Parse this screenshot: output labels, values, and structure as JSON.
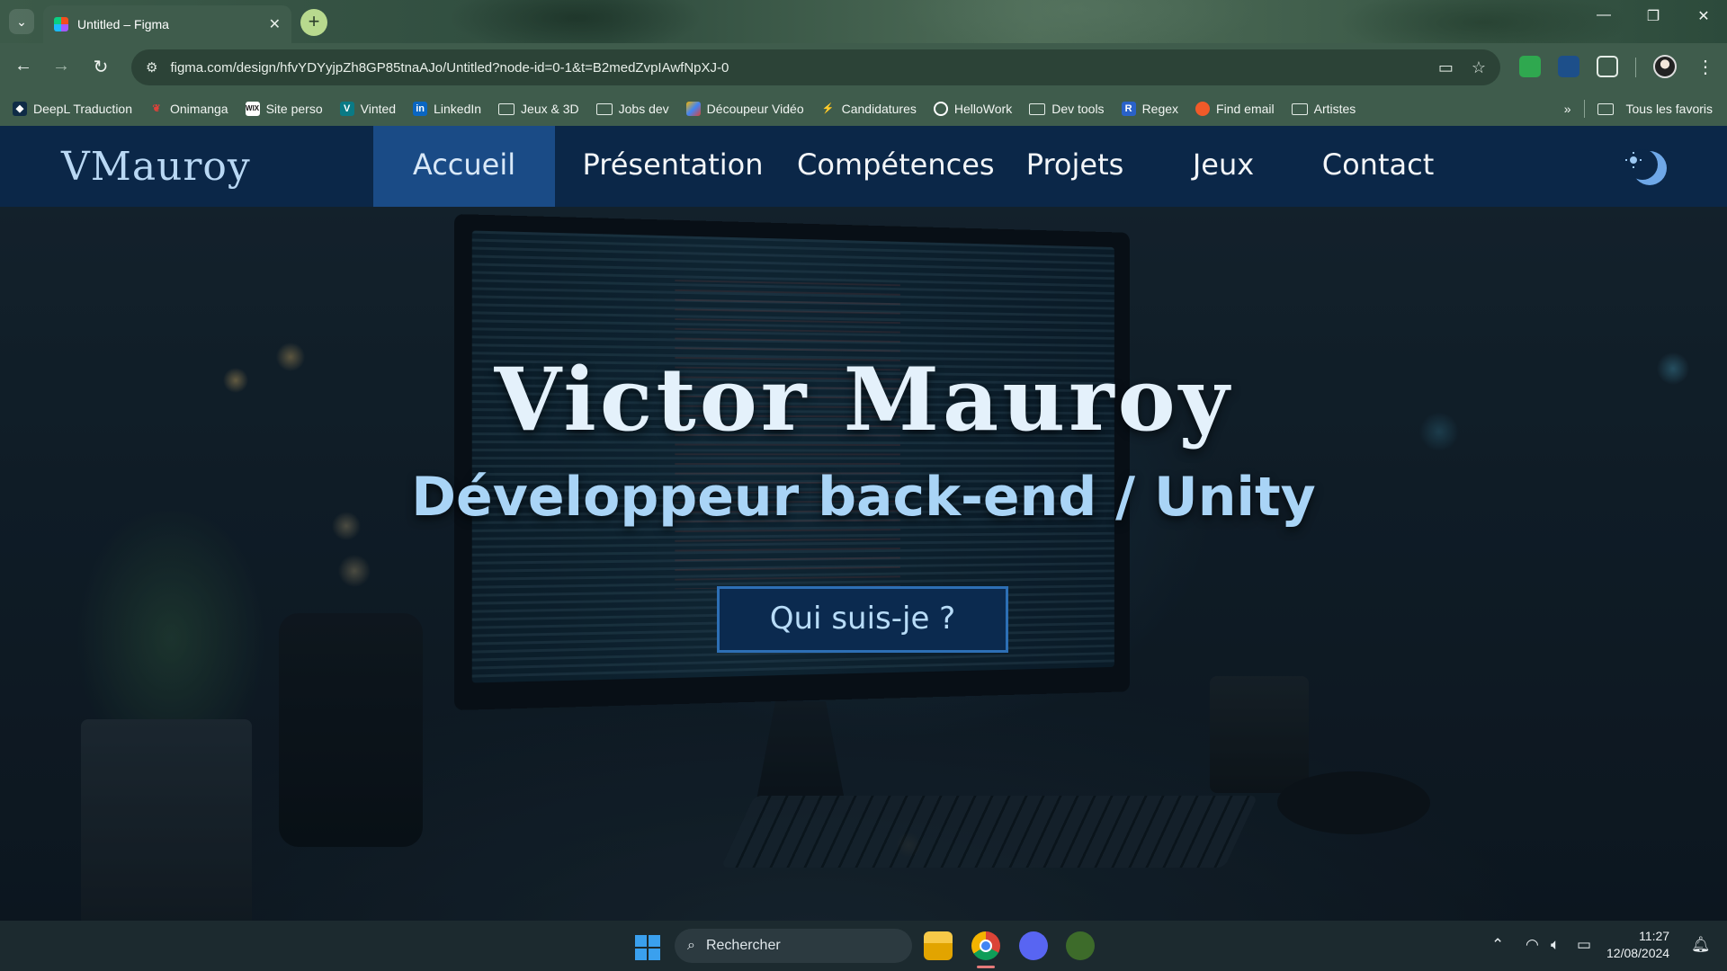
{
  "browser": {
    "tab_title": "Untitled – Figma",
    "url": "figma.com/design/hfvYDYyjpZh8GP85tnaAJo/Untitled?node-id=0-1&t=B2medZvpIAwfNpXJ-0",
    "bookmarks": [
      {
        "label": "DeepL Traduction",
        "icon": "deepl-icon"
      },
      {
        "label": "Onimanga",
        "icon": "onimanga-icon"
      },
      {
        "label": "Site perso",
        "icon": "wix-icon"
      },
      {
        "label": "Vinted",
        "icon": "vinted-icon"
      },
      {
        "label": "LinkedIn",
        "icon": "linkedin-icon"
      },
      {
        "label": "Jeux & 3D",
        "icon": "folder-icon"
      },
      {
        "label": "Jobs dev",
        "icon": "folder-icon"
      },
      {
        "label": "Découpeur Vidéo",
        "icon": "video-cutter-icon"
      },
      {
        "label": "Candidatures",
        "icon": "candidatures-icon"
      },
      {
        "label": "HelloWork",
        "icon": "hellowork-icon"
      },
      {
        "label": "Dev tools",
        "icon": "folder-icon"
      },
      {
        "label": "Regex",
        "icon": "regex-icon"
      },
      {
        "label": "Find email",
        "icon": "find-email-icon"
      },
      {
        "label": "Artistes",
        "icon": "folder-icon"
      }
    ],
    "all_bookmarks_label": "Tous les favoris"
  },
  "site": {
    "brand": "VMauroy",
    "nav": [
      {
        "label": "Accueil",
        "active": true
      },
      {
        "label": "Présentation",
        "active": false
      },
      {
        "label": "Compétences",
        "active": false
      },
      {
        "label": "Projets",
        "active": false
      },
      {
        "label": "Jeux",
        "active": false
      },
      {
        "label": "Contact",
        "active": false
      }
    ],
    "hero": {
      "name": "Victor Mauroy",
      "subtitle": "Développeur back-end / Unity",
      "cta_label": "Qui suis-je ?"
    },
    "colors": {
      "navbar": "#0b2748",
      "nav_active": "#1a4b86",
      "accent_text": "#a9d4f6",
      "cta_border": "#2d6fb5"
    }
  },
  "taskbar": {
    "search_placeholder": "Rechercher",
    "time": "11:27",
    "date": "12/08/2024"
  }
}
